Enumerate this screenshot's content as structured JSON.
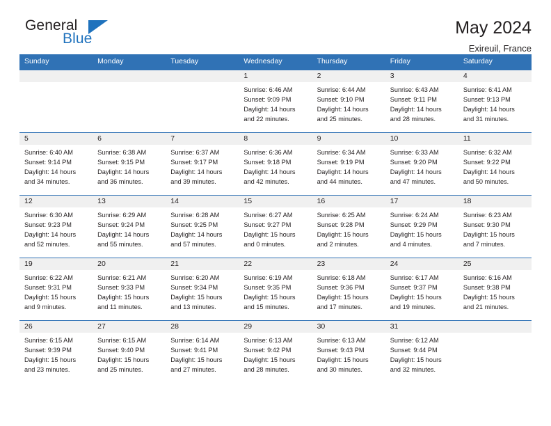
{
  "brand": {
    "name_part1": "General",
    "name_part2": "Blue",
    "flag_icon": "triangle-flag-icon",
    "accent_color": "#1f72bd"
  },
  "header": {
    "title": "May 2024",
    "location": "Exireuil, France"
  },
  "theme": {
    "header_bar_color": "#3072b5",
    "daynum_strip_color": "#f0f0f0",
    "text_color": "#231f20"
  },
  "weekdays": [
    "Sunday",
    "Monday",
    "Tuesday",
    "Wednesday",
    "Thursday",
    "Friday",
    "Saturday"
  ],
  "labels": {
    "sunrise": "Sunrise:",
    "sunset": "Sunset:",
    "daylight": "Daylight:"
  },
  "weeks": [
    [
      {
        "day": "",
        "empty": true
      },
      {
        "day": "",
        "empty": true
      },
      {
        "day": "",
        "empty": true
      },
      {
        "day": "1",
        "sunrise": "Sunrise: 6:46 AM",
        "sunset": "Sunset: 9:09 PM",
        "daylight": "Daylight: 14 hours and 22 minutes."
      },
      {
        "day": "2",
        "sunrise": "Sunrise: 6:44 AM",
        "sunset": "Sunset: 9:10 PM",
        "daylight": "Daylight: 14 hours and 25 minutes."
      },
      {
        "day": "3",
        "sunrise": "Sunrise: 6:43 AM",
        "sunset": "Sunset: 9:11 PM",
        "daylight": "Daylight: 14 hours and 28 minutes."
      },
      {
        "day": "4",
        "sunrise": "Sunrise: 6:41 AM",
        "sunset": "Sunset: 9:13 PM",
        "daylight": "Daylight: 14 hours and 31 minutes."
      }
    ],
    [
      {
        "day": "5",
        "sunrise": "Sunrise: 6:40 AM",
        "sunset": "Sunset: 9:14 PM",
        "daylight": "Daylight: 14 hours and 34 minutes."
      },
      {
        "day": "6",
        "sunrise": "Sunrise: 6:38 AM",
        "sunset": "Sunset: 9:15 PM",
        "daylight": "Daylight: 14 hours and 36 minutes."
      },
      {
        "day": "7",
        "sunrise": "Sunrise: 6:37 AM",
        "sunset": "Sunset: 9:17 PM",
        "daylight": "Daylight: 14 hours and 39 minutes."
      },
      {
        "day": "8",
        "sunrise": "Sunrise: 6:36 AM",
        "sunset": "Sunset: 9:18 PM",
        "daylight": "Daylight: 14 hours and 42 minutes."
      },
      {
        "day": "9",
        "sunrise": "Sunrise: 6:34 AM",
        "sunset": "Sunset: 9:19 PM",
        "daylight": "Daylight: 14 hours and 44 minutes."
      },
      {
        "day": "10",
        "sunrise": "Sunrise: 6:33 AM",
        "sunset": "Sunset: 9:20 PM",
        "daylight": "Daylight: 14 hours and 47 minutes."
      },
      {
        "day": "11",
        "sunrise": "Sunrise: 6:32 AM",
        "sunset": "Sunset: 9:22 PM",
        "daylight": "Daylight: 14 hours and 50 minutes."
      }
    ],
    [
      {
        "day": "12",
        "sunrise": "Sunrise: 6:30 AM",
        "sunset": "Sunset: 9:23 PM",
        "daylight": "Daylight: 14 hours and 52 minutes."
      },
      {
        "day": "13",
        "sunrise": "Sunrise: 6:29 AM",
        "sunset": "Sunset: 9:24 PM",
        "daylight": "Daylight: 14 hours and 55 minutes."
      },
      {
        "day": "14",
        "sunrise": "Sunrise: 6:28 AM",
        "sunset": "Sunset: 9:25 PM",
        "daylight": "Daylight: 14 hours and 57 minutes."
      },
      {
        "day": "15",
        "sunrise": "Sunrise: 6:27 AM",
        "sunset": "Sunset: 9:27 PM",
        "daylight": "Daylight: 15 hours and 0 minutes."
      },
      {
        "day": "16",
        "sunrise": "Sunrise: 6:25 AM",
        "sunset": "Sunset: 9:28 PM",
        "daylight": "Daylight: 15 hours and 2 minutes."
      },
      {
        "day": "17",
        "sunrise": "Sunrise: 6:24 AM",
        "sunset": "Sunset: 9:29 PM",
        "daylight": "Daylight: 15 hours and 4 minutes."
      },
      {
        "day": "18",
        "sunrise": "Sunrise: 6:23 AM",
        "sunset": "Sunset: 9:30 PM",
        "daylight": "Daylight: 15 hours and 7 minutes."
      }
    ],
    [
      {
        "day": "19",
        "sunrise": "Sunrise: 6:22 AM",
        "sunset": "Sunset: 9:31 PM",
        "daylight": "Daylight: 15 hours and 9 minutes."
      },
      {
        "day": "20",
        "sunrise": "Sunrise: 6:21 AM",
        "sunset": "Sunset: 9:33 PM",
        "daylight": "Daylight: 15 hours and 11 minutes."
      },
      {
        "day": "21",
        "sunrise": "Sunrise: 6:20 AM",
        "sunset": "Sunset: 9:34 PM",
        "daylight": "Daylight: 15 hours and 13 minutes."
      },
      {
        "day": "22",
        "sunrise": "Sunrise: 6:19 AM",
        "sunset": "Sunset: 9:35 PM",
        "daylight": "Daylight: 15 hours and 15 minutes."
      },
      {
        "day": "23",
        "sunrise": "Sunrise: 6:18 AM",
        "sunset": "Sunset: 9:36 PM",
        "daylight": "Daylight: 15 hours and 17 minutes."
      },
      {
        "day": "24",
        "sunrise": "Sunrise: 6:17 AM",
        "sunset": "Sunset: 9:37 PM",
        "daylight": "Daylight: 15 hours and 19 minutes."
      },
      {
        "day": "25",
        "sunrise": "Sunrise: 6:16 AM",
        "sunset": "Sunset: 9:38 PM",
        "daylight": "Daylight: 15 hours and 21 minutes."
      }
    ],
    [
      {
        "day": "26",
        "sunrise": "Sunrise: 6:15 AM",
        "sunset": "Sunset: 9:39 PM",
        "daylight": "Daylight: 15 hours and 23 minutes."
      },
      {
        "day": "27",
        "sunrise": "Sunrise: 6:15 AM",
        "sunset": "Sunset: 9:40 PM",
        "daylight": "Daylight: 15 hours and 25 minutes."
      },
      {
        "day": "28",
        "sunrise": "Sunrise: 6:14 AM",
        "sunset": "Sunset: 9:41 PM",
        "daylight": "Daylight: 15 hours and 27 minutes."
      },
      {
        "day": "29",
        "sunrise": "Sunrise: 6:13 AM",
        "sunset": "Sunset: 9:42 PM",
        "daylight": "Daylight: 15 hours and 28 minutes."
      },
      {
        "day": "30",
        "sunrise": "Sunrise: 6:13 AM",
        "sunset": "Sunset: 9:43 PM",
        "daylight": "Daylight: 15 hours and 30 minutes."
      },
      {
        "day": "31",
        "sunrise": "Sunrise: 6:12 AM",
        "sunset": "Sunset: 9:44 PM",
        "daylight": "Daylight: 15 hours and 32 minutes."
      },
      {
        "day": "",
        "empty": true
      }
    ]
  ]
}
